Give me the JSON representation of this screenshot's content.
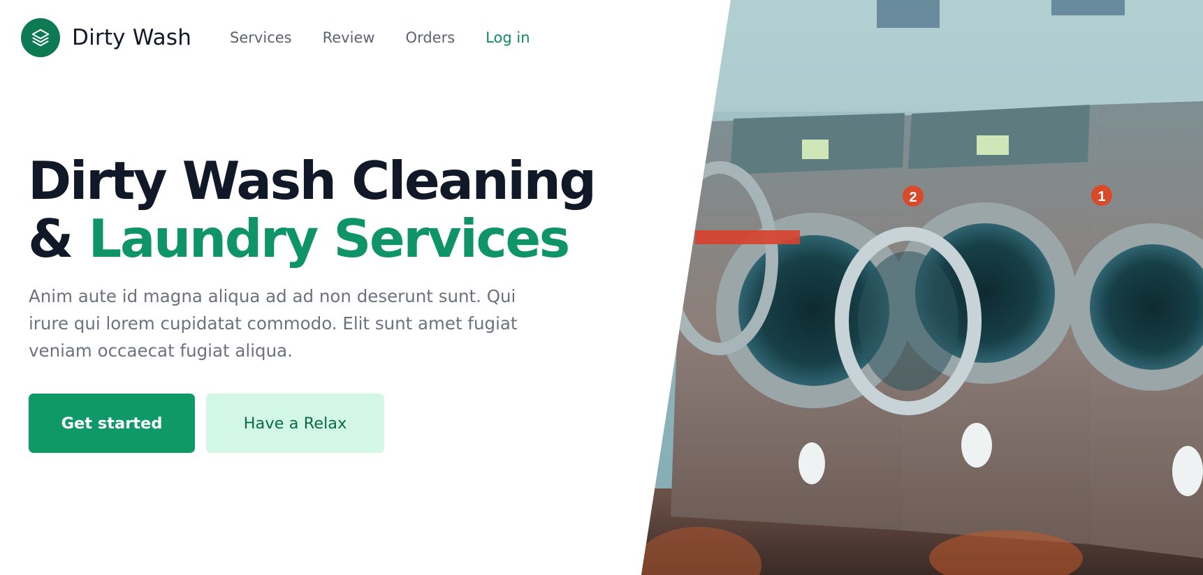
{
  "brand": {
    "name": "Dirty Wash",
    "logo_icon": "stacked-layers-icon"
  },
  "nav": {
    "links": [
      {
        "label": "Services"
      },
      {
        "label": "Review"
      },
      {
        "label": "Orders"
      }
    ],
    "login_label": "Log in"
  },
  "hero": {
    "headline_line1": "Dirty Wash Cleaning",
    "headline_amp": "& ",
    "headline_accent": "Laundry Services",
    "description": "Anim aute id magna aliqua ad ad non deserunt sunt. Qui irure qui lorem cupidatat commodo. Elit sunt amet fugiat veniam occaecat fugiat aliqua.",
    "primary_button": "Get started",
    "secondary_button": "Have a Relax",
    "image_subject": "laundromat-washing-machines",
    "machine_numbers": [
      "2",
      "1"
    ]
  },
  "colors": {
    "accent": "#0e9466",
    "primary_button": "#0f9966",
    "secondary_button": "#d3f7e6",
    "heading": "#111827",
    "body_text": "#6b7280"
  }
}
